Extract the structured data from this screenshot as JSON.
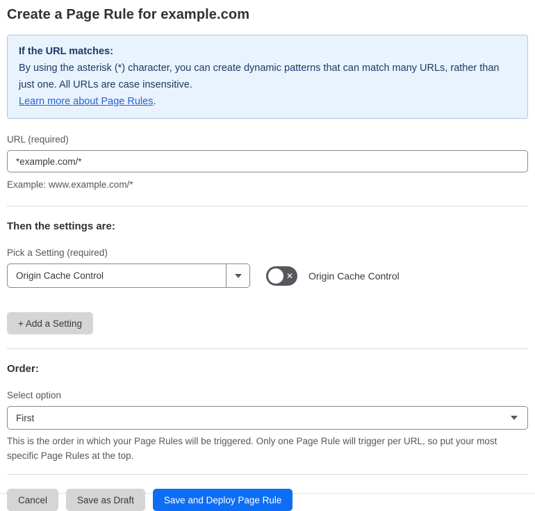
{
  "page": {
    "title": "Create a Page Rule for example.com"
  },
  "info_box": {
    "heading": "If the URL matches:",
    "body": "By using the asterisk (*) character, you can create dynamic patterns that can match many URLs, rather than just one. All URLs are case insensitive.",
    "link_label": "Learn more about Page Rules",
    "link_suffix": "."
  },
  "url_section": {
    "label": "URL (required)",
    "value": "*example.com/*",
    "helper": "Example: www.example.com/*"
  },
  "settings_section": {
    "heading": "Then the settings are:",
    "picker_label": "Pick a Setting (required)",
    "picker_value": "Origin Cache Control",
    "toggle_label": "Origin Cache Control",
    "toggle_state": "off",
    "toggle_icon": "✕",
    "add_button_label": "+ Add a Setting"
  },
  "order_section": {
    "heading": "Order:",
    "select_label": "Select option",
    "select_value": "First",
    "helper": "This is the order in which your Page Rules will be triggered. Only one Page Rule will trigger per URL, so put your most specific Page Rules at the top."
  },
  "footer": {
    "cancel_label": "Cancel",
    "save_draft_label": "Save as Draft",
    "save_deploy_label": "Save and Deploy Page Rule"
  },
  "colors": {
    "accent_blue": "#0d6ef5",
    "info_bg": "#e9f3fd",
    "info_border": "#a9c9e9",
    "info_text": "#1b3a66",
    "link_blue": "#2762d9",
    "toggle_off_bg": "#56575c",
    "button_gray": "#d5d5d5"
  }
}
